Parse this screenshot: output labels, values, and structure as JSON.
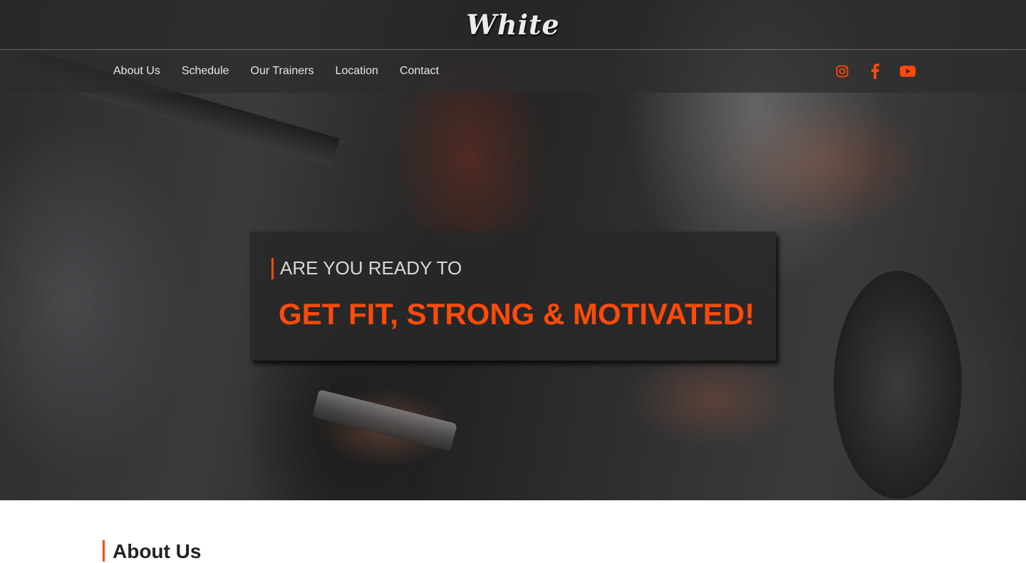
{
  "brand": {
    "logo_text": "White"
  },
  "nav": {
    "items": [
      {
        "label": "About Us"
      },
      {
        "label": "Schedule"
      },
      {
        "label": "Our Trainers"
      },
      {
        "label": "Location"
      },
      {
        "label": "Contact"
      }
    ]
  },
  "social": {
    "icons": [
      "instagram-icon",
      "facebook-icon",
      "youtube-icon"
    ],
    "color": "#ff4a0a"
  },
  "hero": {
    "subtitle": "ARE YOU READY TO",
    "headline": "GET FIT, STRONG & MOTIVATED!"
  },
  "about": {
    "title": "About Us"
  },
  "colors": {
    "accent": "#ff4a0a"
  }
}
